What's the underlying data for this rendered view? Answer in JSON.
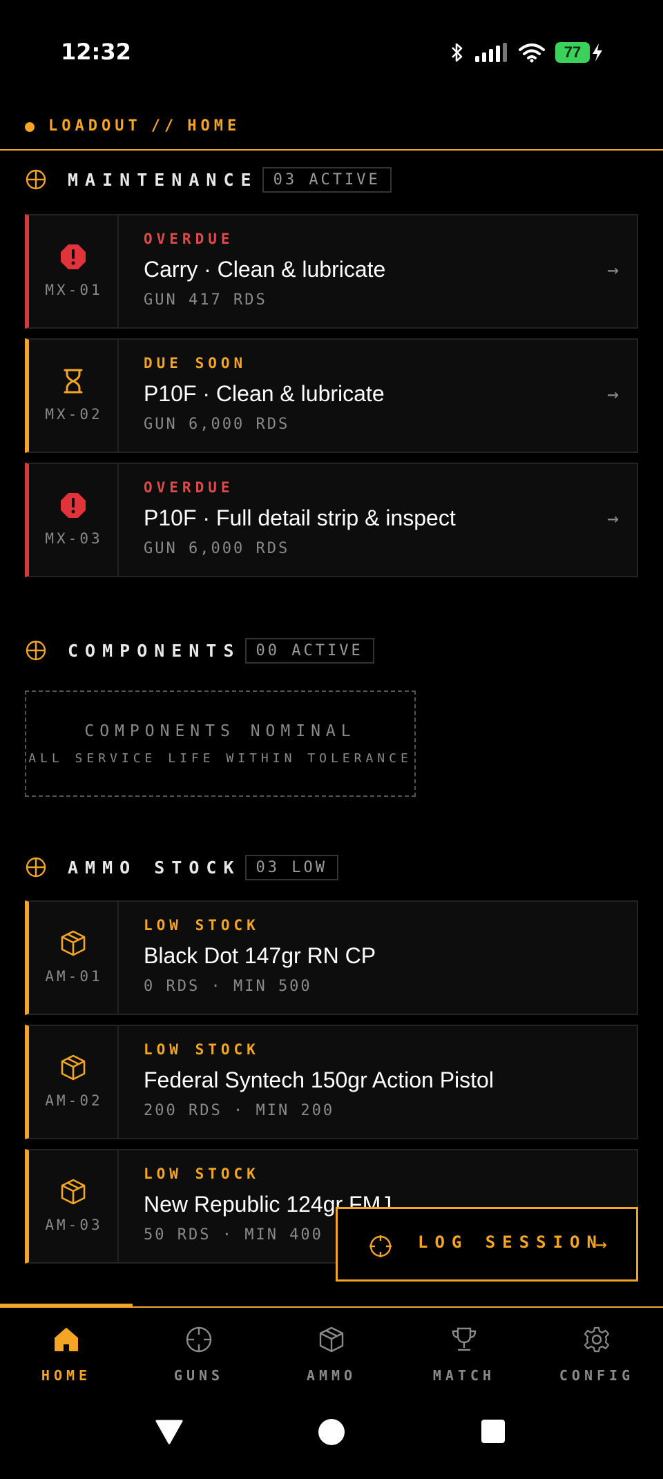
{
  "status_bar": {
    "time": "12:32",
    "battery": "77"
  },
  "header": {
    "app": "LOADOUT",
    "separator": "//",
    "page": "HOME"
  },
  "maintenance": {
    "title": "MAINTENANCE",
    "badge": "03 ACTIVE",
    "items": [
      {
        "id": "MX-01",
        "status": "OVERDUE",
        "title": "Carry · Clean & lubricate",
        "meta": "GUN 417 RDS",
        "level": "overdue"
      },
      {
        "id": "MX-02",
        "status": "DUE SOON",
        "title": "P10F · Clean & lubricate",
        "meta": "GUN 6,000 RDS",
        "level": "due-soon"
      },
      {
        "id": "MX-03",
        "status": "OVERDUE",
        "title": "P10F · Full detail strip & inspect",
        "meta": "GUN 6,000 RDS",
        "level": "overdue"
      }
    ],
    "arrow": "→"
  },
  "components": {
    "title": "COMPONENTS",
    "badge": "00 ACTIVE",
    "empty_title": "COMPONENTS NOMINAL",
    "empty_subtitle": "ALL SERVICE LIFE WITHIN TOLERANCE"
  },
  "ammo": {
    "title": "AMMO STOCK",
    "badge": "03 LOW",
    "items": [
      {
        "id": "AM-01",
        "status": "LOW STOCK",
        "title": "Black Dot 147gr RN CP",
        "meta": "0 RDS · MIN 500"
      },
      {
        "id": "AM-02",
        "status": "LOW STOCK",
        "title": "Federal Syntech 150gr Action Pistol",
        "meta": "200 RDS · MIN 200"
      },
      {
        "id": "AM-03",
        "status": "LOW STOCK",
        "title": "New Republic 124gr FMJ",
        "meta": "50 RDS · MIN 400"
      }
    ]
  },
  "fab": {
    "label": "LOG SESSION",
    "arrow": "→"
  },
  "nav": [
    {
      "label": "HOME",
      "icon": "home-icon",
      "active": true
    },
    {
      "label": "GUNS",
      "icon": "crosshair-icon",
      "active": false
    },
    {
      "label": "AMMO",
      "icon": "box-icon",
      "active": false
    },
    {
      "label": "MATCH",
      "icon": "trophy-icon",
      "active": false
    },
    {
      "label": "CONFIG",
      "icon": "gear-icon",
      "active": false
    }
  ],
  "colors": {
    "accent": "#f5a524",
    "danger": "#e04a4a",
    "background": "#000000"
  }
}
